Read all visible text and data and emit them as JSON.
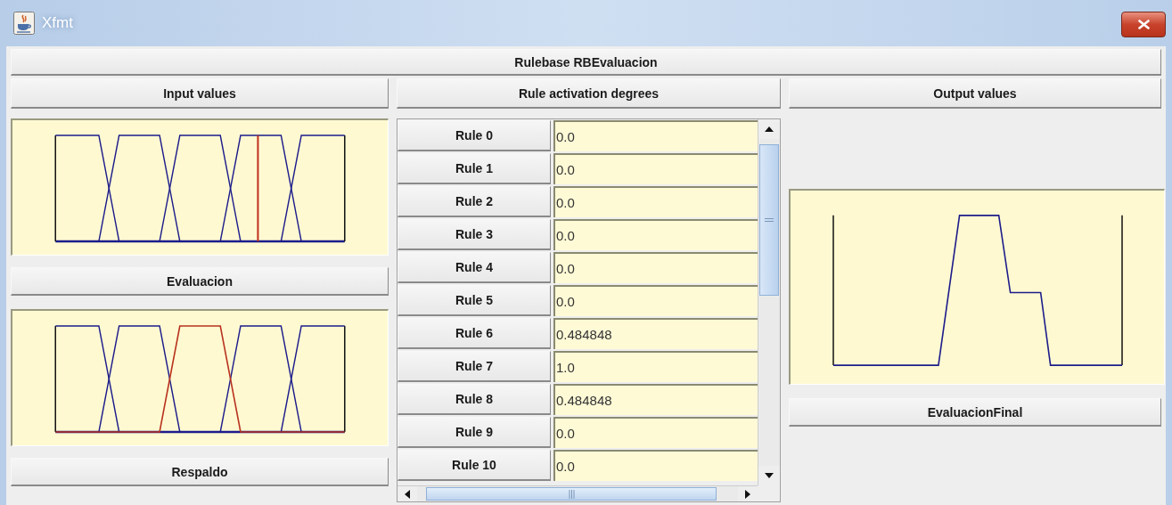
{
  "window": {
    "title": "Xfmt"
  },
  "rulebase": {
    "title": "Rulebase RBEvaluacion"
  },
  "inputs": {
    "header": "Input values",
    "variables": [
      {
        "name": "Evaluacion",
        "marker": {
          "level": 0.7
        },
        "sets": [
          {
            "active": false
          },
          {
            "active": false
          },
          {
            "active": false
          },
          {
            "active": false
          },
          {
            "active": false
          }
        ]
      },
      {
        "name": "Respaldo",
        "sets": [
          {
            "active": false
          },
          {
            "active": false
          },
          {
            "active": true
          },
          {
            "active": false
          },
          {
            "active": false
          }
        ]
      }
    ]
  },
  "rules": {
    "header": "Rule activation degrees",
    "rows": [
      {
        "label": "Rule 0",
        "value": "0.0"
      },
      {
        "label": "Rule 1",
        "value": "0.0"
      },
      {
        "label": "Rule 2",
        "value": "0.0"
      },
      {
        "label": "Rule 3",
        "value": "0.0"
      },
      {
        "label": "Rule 4",
        "value": "0.0"
      },
      {
        "label": "Rule 5",
        "value": "0.0"
      },
      {
        "label": "Rule 6",
        "value": "0.484848"
      },
      {
        "label": "Rule 7",
        "value": "1.0"
      },
      {
        "label": "Rule 8",
        "value": "0.484848"
      },
      {
        "label": "Rule 9",
        "value": "0.0"
      },
      {
        "label": "Rule 10",
        "value": "0.0"
      }
    ]
  },
  "outputs": {
    "header": "Output values",
    "variables": [
      {
        "name": "EvaluacionFinal"
      }
    ]
  }
}
